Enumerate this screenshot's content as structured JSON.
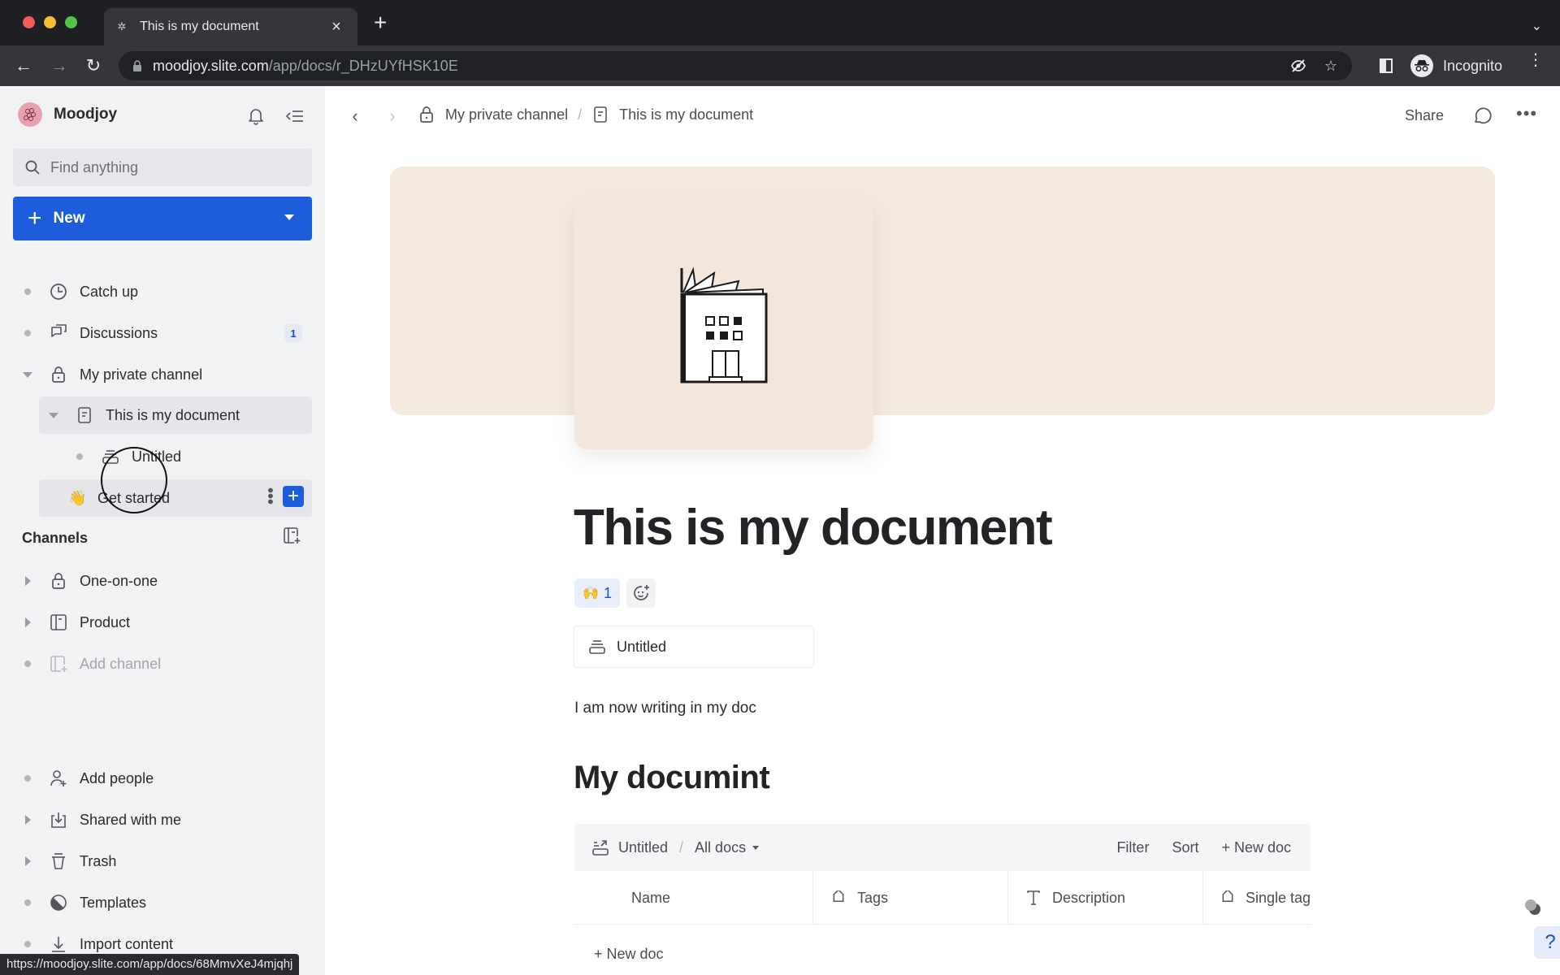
{
  "browser": {
    "tab_title": "This is my document",
    "url_host": "moodjoy.slite.com",
    "url_path": "/app/docs/r_DHzUYfHSK10E",
    "profile_label": "Incognito",
    "status_url": "https://moodjoy.slite.com/app/docs/68MmvXeJ4mjqhj"
  },
  "sidebar": {
    "workspace_name": "Moodjoy",
    "search_placeholder": "Find anything",
    "new_button_label": "New",
    "items": [
      {
        "label": "Catch up",
        "icon": "clock-icon"
      },
      {
        "label": "Discussions",
        "icon": "discussion-icon",
        "badge": "1"
      },
      {
        "label": "My private channel",
        "icon": "lock-icon",
        "expanded": true
      },
      {
        "label": "This is my document",
        "icon": "document-icon",
        "expanded": true,
        "selected": true
      },
      {
        "label": "Untitled",
        "icon": "collection-icon"
      },
      {
        "label": "Get started",
        "icon": "waving-hand-emoji",
        "emoji": "👋"
      }
    ],
    "channels_title": "Channels",
    "channels": [
      {
        "label": "One-on-one",
        "icon": "lock-icon"
      },
      {
        "label": "Product",
        "icon": "channel-icon"
      },
      {
        "label": "Add channel",
        "icon": "add-channel-icon",
        "disabled": true
      }
    ],
    "footer_items": [
      {
        "label": "Add people",
        "icon": "add-person-icon"
      },
      {
        "label": "Shared with me",
        "icon": "inbox-download-icon"
      },
      {
        "label": "Trash",
        "icon": "trash-icon"
      },
      {
        "label": "Templates",
        "icon": "templates-icon"
      },
      {
        "label": "Import content",
        "icon": "import-icon"
      }
    ]
  },
  "main": {
    "breadcrumb": [
      {
        "label": "My private channel",
        "icon": "lock-icon"
      },
      {
        "label": "This is my document",
        "icon": "document-icon"
      }
    ],
    "breadcrumb_separator": "/",
    "share_label": "Share",
    "doc_title": "This is my document",
    "reaction": {
      "emoji": "🙌",
      "count": "1"
    },
    "embed_label": "Untitled",
    "paragraph": "I am now writing in my doc",
    "heading2": "My documint",
    "database": {
      "collection_name": "Untitled",
      "separator": "/",
      "view_name": "All docs",
      "filter_label": "Filter",
      "sort_label": "Sort",
      "new_doc_label": "+ New doc",
      "columns": [
        {
          "label": "Name",
          "icon": ""
        },
        {
          "label": "Tags",
          "icon": "tag-icon"
        },
        {
          "label": "Description",
          "icon": "text-icon"
        },
        {
          "label": "Single tag",
          "icon": "tag-icon"
        }
      ],
      "add_row_label": "+ New doc"
    },
    "help_label": "?"
  },
  "colors": {
    "accent": "#1d5ddb",
    "sidebar_bg": "#f1f2f4",
    "cover_bg": "#f3e9df",
    "badge_bg": "#e4e9f6"
  }
}
